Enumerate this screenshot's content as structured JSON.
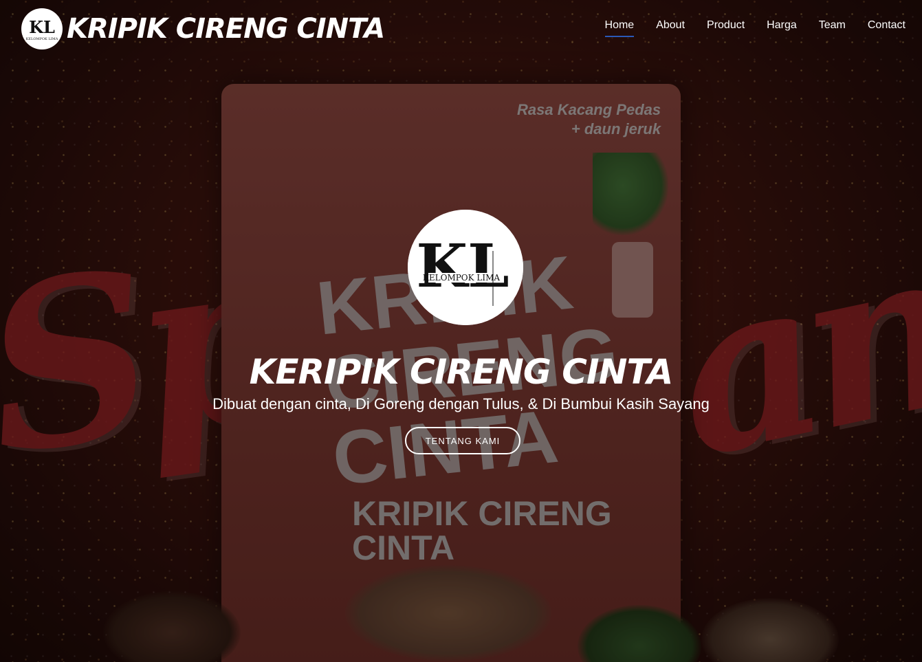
{
  "brand": {
    "name": "KRIPIK CIRENG CINTA",
    "logo_letters": "KL",
    "logo_caption": "KELOMPOK LIMA"
  },
  "nav": {
    "items": [
      {
        "label": "Home",
        "active": true
      },
      {
        "label": "About",
        "active": false
      },
      {
        "label": "Product",
        "active": false
      },
      {
        "label": "Harga",
        "active": false
      },
      {
        "label": "Team",
        "active": false
      },
      {
        "label": "Contact",
        "active": false
      }
    ]
  },
  "hero": {
    "title": "KERIPIK CIRENG CINTA",
    "subtitle": "Dibuat dengan cinta, Di Goreng dengan Tulus, & Di Bumbui Kasih Sayang",
    "cta_label": "TENTANG KAMI",
    "logo_letters": "KL",
    "logo_caption": "KELOMPOK LIMA"
  },
  "background": {
    "script_left": "Spci",
    "script_right": "anut",
    "package": {
      "flavor_line1": "Rasa Kacang Pedas",
      "flavor_line2": "+ daun jeruk",
      "big_text_line1": "KRIPIK",
      "big_text_line2": "CIRENG",
      "big_text_line3": "CINTA",
      "best_line1": "KRIPIK CIRENG",
      "best_line2": "CINTA"
    }
  },
  "colors": {
    "nav_active_underline": "#2b59b8",
    "script_red": "#b0262c",
    "text": "#ffffff"
  }
}
